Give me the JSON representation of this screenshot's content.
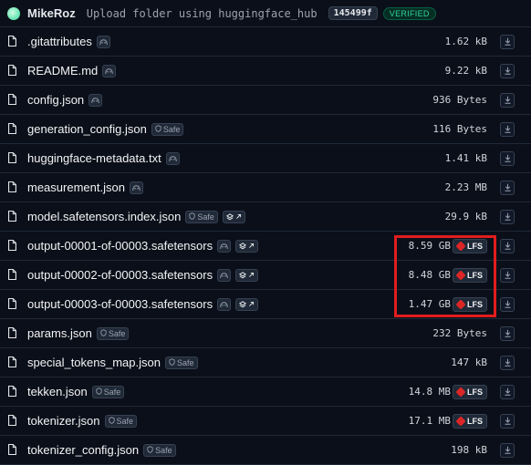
{
  "commit": {
    "author": "MikeRoz",
    "message": "Upload folder using huggingface_hub",
    "sha": "145499f",
    "verified_label": "VERIFIED"
  },
  "safe_label": "Safe",
  "lfs_label": "LFS",
  "files": [
    {
      "name": ".gitattributes",
      "size": "1.62 kB",
      "badge": "scan",
      "lfs": false
    },
    {
      "name": "README.md",
      "size": "9.22 kB",
      "badge": "scan",
      "lfs": false
    },
    {
      "name": "config.json",
      "size": "936 Bytes",
      "badge": "scan",
      "lfs": false
    },
    {
      "name": "generation_config.json",
      "size": "116 Bytes",
      "badge": "safe",
      "lfs": false
    },
    {
      "name": "huggingface-metadata.txt",
      "size": "1.41 kB",
      "badge": "scan",
      "lfs": false
    },
    {
      "name": "measurement.json",
      "size": "2.23 MB",
      "badge": "scan",
      "lfs": false
    },
    {
      "name": "model.safetensors.index.json",
      "size": "29.9 kB",
      "badge": "safe+ext",
      "lfs": false
    },
    {
      "name": "output-00001-of-00003.safetensors",
      "size": "8.59 GB",
      "badge": "scan+ext",
      "lfs": true
    },
    {
      "name": "output-00002-of-00003.safetensors",
      "size": "8.48 GB",
      "badge": "scan+ext",
      "lfs": true
    },
    {
      "name": "output-00003-of-00003.safetensors",
      "size": "1.47 GB",
      "badge": "scan+ext",
      "lfs": true
    },
    {
      "name": "params.json",
      "size": "232 Bytes",
      "badge": "safe",
      "lfs": false
    },
    {
      "name": "special_tokens_map.json",
      "size": "147 kB",
      "badge": "safe",
      "lfs": false
    },
    {
      "name": "tekken.json",
      "size": "14.8 MB",
      "badge": "safe",
      "lfs": true
    },
    {
      "name": "tokenizer.json",
      "size": "17.1 MB",
      "badge": "safe",
      "lfs": true
    },
    {
      "name": "tokenizer_config.json",
      "size": "198 kB",
      "badge": "safe",
      "lfs": false
    }
  ],
  "colors": {
    "background": "#0b0f19",
    "lfs_accent": "#dc2626",
    "highlight_box": "#e11d1d",
    "verified": "#34d399"
  },
  "icons": {
    "file": "file-icon",
    "scan": "scan-icon",
    "safe": "shield-icon",
    "external": "external-link-icon",
    "download": "download-icon"
  }
}
